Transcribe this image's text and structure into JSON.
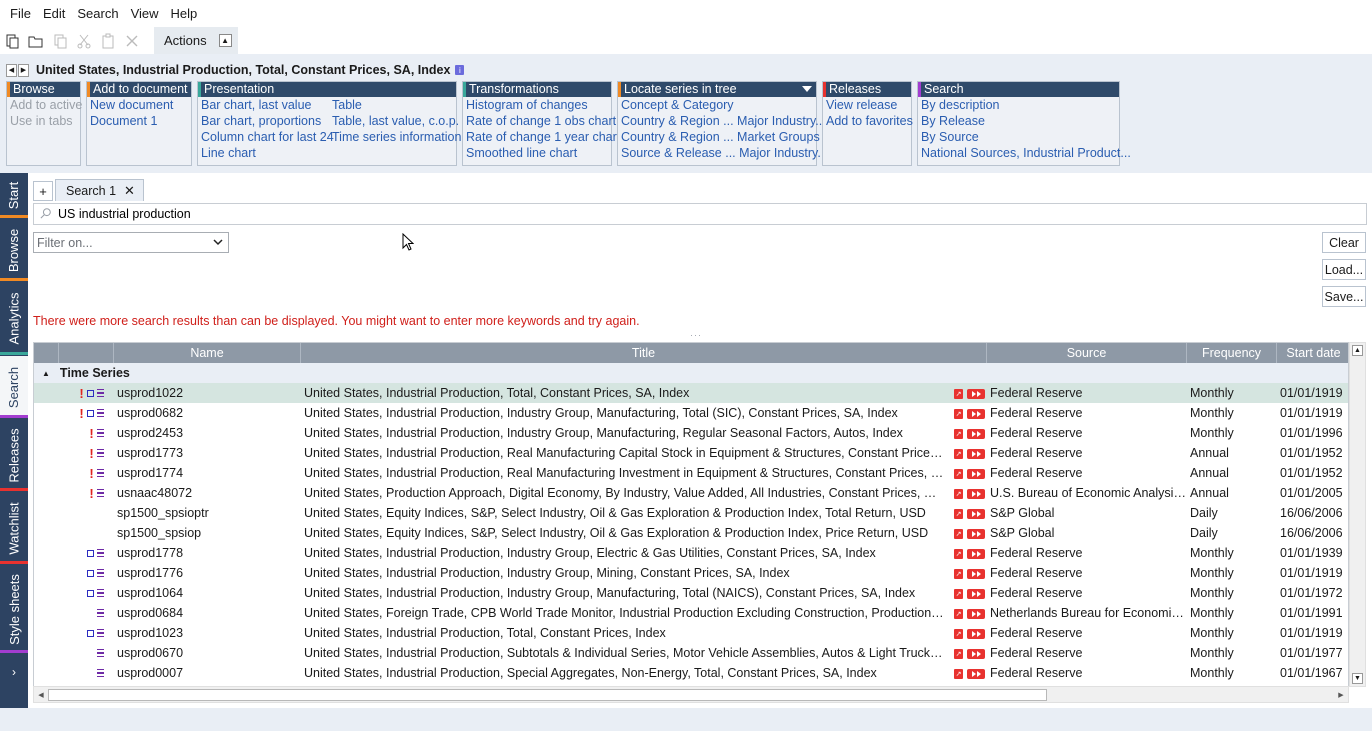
{
  "menu": [
    "File",
    "Edit",
    "Search",
    "View",
    "Help"
  ],
  "toolbar": {
    "actions_label": "Actions",
    "icons": [
      "new-document-icon",
      "open-folder-icon",
      "copy-icon",
      "cut-icon",
      "paste-icon",
      "delete-icon"
    ]
  },
  "series_title": "United States, Industrial Production, Total, Constant Prices, SA, Index",
  "ribbon": {
    "browse": {
      "title": "Browse",
      "items": [
        "Add to active",
        "Use in tabs"
      ]
    },
    "add_to_document": {
      "title": "Add to document",
      "items": [
        "New document",
        "Document 1"
      ]
    },
    "presentation": {
      "title": "Presentation",
      "col1": [
        "Bar chart, last value",
        "Bar chart, proportions",
        "Column chart for last 24",
        "Line chart"
      ],
      "col2": [
        "Table",
        "Table, last value, c.o.p.",
        "Time series information"
      ]
    },
    "transformations": {
      "title": "Transformations",
      "items": [
        "Histogram of changes",
        "Rate of change 1 obs chart",
        "Rate of change 1 year chart",
        "Smoothed line chart"
      ]
    },
    "locate": {
      "title": "Locate series in tree",
      "items": [
        "Concept & Category",
        "Country & Region ... Major Industry...",
        "Country & Region ... Market Groups",
        "Source & Release ... Major Industry..."
      ]
    },
    "releases": {
      "title": "Releases",
      "items": [
        "View release",
        "Add to favorites"
      ]
    },
    "search": {
      "title": "Search",
      "items": [
        "By description",
        "By Release",
        "By Source",
        "National Sources, Industrial Product..."
      ]
    }
  },
  "left_tabs": [
    "Start",
    "Browse",
    "Analytics",
    "Search",
    "Releases",
    "Watchlist",
    "Style sheets"
  ],
  "doc_tab": {
    "plus": "+",
    "label": "Search 1",
    "close": "✕"
  },
  "search_query": "US industrial production",
  "filter_placeholder": "Filter on...",
  "buttons": {
    "clear": "Clear",
    "load": "Load...",
    "save": "Save..."
  },
  "warning": "There were more search results than can be displayed. You might want to enter more keywords and try again.",
  "table": {
    "headers": {
      "name": "Name",
      "title": "Title",
      "source": "Source",
      "frequency": "Frequency",
      "start": "Start date"
    },
    "group": "Time Series",
    "rows": [
      {
        "bang": true,
        "sq": true,
        "name": "usprod1022",
        "title": "United States, Industrial Production, Total, Constant Prices, SA, Index",
        "source": "Federal Reserve",
        "freq": "Monthly",
        "start": "01/01/1919",
        "selected": true
      },
      {
        "bang": true,
        "sq": true,
        "name": "usprod0682",
        "title": "United States, Industrial Production, Industry Group, Manufacturing, Total (SIC), Constant Prices, SA, Index",
        "source": "Federal Reserve",
        "freq": "Monthly",
        "start": "01/01/1919"
      },
      {
        "bang": true,
        "sq": false,
        "name": "usprod2453",
        "title": "United States, Industrial Production, Industry Group, Manufacturing, Regular Seasonal Factors, Autos, Index",
        "source": "Federal Reserve",
        "freq": "Monthly",
        "start": "01/01/1996"
      },
      {
        "bang": true,
        "sq": false,
        "name": "usprod1773",
        "title": "United States, Industrial Production, Real Manufacturing Capital Stock in Equipment & Structures, Constant Prices, Chain...",
        "source": "Federal Reserve",
        "freq": "Annual",
        "start": "01/01/1952"
      },
      {
        "bang": true,
        "sq": false,
        "name": "usprod1774",
        "title": "United States, Industrial Production, Real Manufacturing Investment in Equipment & Structures, Constant Prices, Chaine...",
        "source": "Federal Reserve",
        "freq": "Annual",
        "start": "01/01/1952"
      },
      {
        "bang": true,
        "sq": false,
        "name": "usnaac48072",
        "title": "United States, Production Approach, Digital Economy, By Industry, Value Added, All Industries, Constant Prices, Chained,...",
        "source": "U.S. Bureau of Economic Analysis (...",
        "freq": "Annual",
        "start": "01/01/2005"
      },
      {
        "bang": false,
        "sq": false,
        "lines": false,
        "name": "sp1500_spsioptr",
        "title": "United States, Equity Indices, S&P, Select Industry, Oil & Gas Exploration & Production Index, Total Return, USD",
        "source": "S&P Global",
        "freq": "Daily",
        "start": "16/06/2006"
      },
      {
        "bang": false,
        "sq": false,
        "lines": false,
        "name": "sp1500_spsiop",
        "title": "United States, Equity Indices, S&P, Select Industry, Oil & Gas Exploration & Production Index, Price Return, USD",
        "source": "S&P Global",
        "freq": "Daily",
        "start": "16/06/2006"
      },
      {
        "bang": false,
        "sq": true,
        "name": "usprod1778",
        "title": "United States, Industrial Production, Industry Group, Electric & Gas Utilities, Constant Prices, SA, Index",
        "source": "Federal Reserve",
        "freq": "Monthly",
        "start": "01/01/1939"
      },
      {
        "bang": false,
        "sq": true,
        "name": "usprod1776",
        "title": "United States, Industrial Production, Industry Group, Mining, Constant Prices, SA, Index",
        "source": "Federal Reserve",
        "freq": "Monthly",
        "start": "01/01/1919"
      },
      {
        "bang": false,
        "sq": true,
        "name": "usprod1064",
        "title": "United States, Industrial Production, Industry Group, Manufacturing, Total (NAICS), Constant Prices, SA, Index",
        "source": "Federal Reserve",
        "freq": "Monthly",
        "start": "01/01/1972"
      },
      {
        "bang": false,
        "sq": false,
        "name": "usprod0684",
        "title": "United States, Foreign Trade, CPB World Trade Monitor, Industrial Production Excluding Construction, Production Weight...",
        "source": "Netherlands Bureau for Economic P...",
        "freq": "Monthly",
        "start": "01/01/1991"
      },
      {
        "bang": false,
        "sq": true,
        "name": "usprod1023",
        "title": "United States, Industrial Production, Total, Constant Prices, Index",
        "source": "Federal Reserve",
        "freq": "Monthly",
        "start": "01/01/1919"
      },
      {
        "bang": false,
        "sq": false,
        "name": "usprod0670",
        "title": "United States, Industrial Production, Subtotals & Individual Series, Motor Vehicle Assemblies, Autos & Light Trucks, SA, AR",
        "source": "Federal Reserve",
        "freq": "Monthly",
        "start": "01/01/1977"
      },
      {
        "bang": false,
        "sq": false,
        "name": "usprod0007",
        "title": "United States, Industrial Production, Special Aggregates, Non-Energy, Total, Constant Prices, SA, Index",
        "source": "Federal Reserve",
        "freq": "Monthly",
        "start": "01/01/1967"
      }
    ]
  },
  "colors": {
    "accent_browse": "#f08a24",
    "accent_add": "#f08a24",
    "accent_presentation": "#3aa89b",
    "accent_transform": "#3aa89b",
    "accent_locate": "#f08a24",
    "accent_releases": "#e8322f",
    "accent_search": "#a23dd0",
    "nav_bg": "#2d4362",
    "warning": "#d0201b"
  }
}
